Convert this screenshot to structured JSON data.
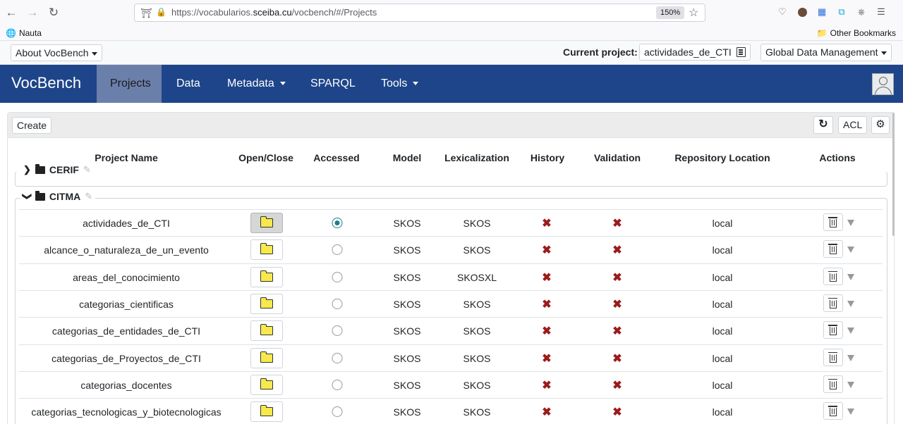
{
  "browser": {
    "url_prefix": "https://vocabularios.",
    "url_domain": "sceiba.cu",
    "url_path": "/vocbench/#/Projects",
    "zoom": "150%",
    "bookmark_nauta": "Nauta",
    "bookmark_other": "Other Bookmarks"
  },
  "topbar": {
    "about": "About VocBench",
    "current_project_label": "Current project:",
    "current_project": "actividades_de_CTI",
    "global": "Global Data Management"
  },
  "navbar": {
    "brand": "VocBench",
    "items": [
      "Projects",
      "Data",
      "Metadata",
      "SPARQL",
      "Tools"
    ]
  },
  "panel": {
    "create": "Create",
    "acl": "ACL"
  },
  "columns": [
    "Project Name",
    "Open/Close",
    "Accessed",
    "Model",
    "Lexicalization",
    "History",
    "Validation",
    "Repository Location",
    "Actions"
  ],
  "groups": [
    {
      "name": "CERIF"
    },
    {
      "name": "CITMA"
    }
  ],
  "projects": [
    {
      "name": "actividades_de_CTI",
      "open": true,
      "accessed": true,
      "model": "SKOS",
      "lex": "SKOS",
      "history": "✖",
      "validation": "✖",
      "location": "local"
    },
    {
      "name": "alcance_o_naturaleza_de_un_evento",
      "open": false,
      "accessed": false,
      "model": "SKOS",
      "lex": "SKOS",
      "history": "✖",
      "validation": "✖",
      "location": "local"
    },
    {
      "name": "areas_del_conocimiento",
      "open": false,
      "accessed": false,
      "model": "SKOS",
      "lex": "SKOSXL",
      "history": "✖",
      "validation": "✖",
      "location": "local"
    },
    {
      "name": "categorias_cientificas",
      "open": false,
      "accessed": false,
      "model": "SKOS",
      "lex": "SKOS",
      "history": "✖",
      "validation": "✖",
      "location": "local"
    },
    {
      "name": "categorias_de_entidades_de_CTI",
      "open": false,
      "accessed": false,
      "model": "SKOS",
      "lex": "SKOS",
      "history": "✖",
      "validation": "✖",
      "location": "local"
    },
    {
      "name": "categorias_de_Proyectos_de_CTI",
      "open": false,
      "accessed": false,
      "model": "SKOS",
      "lex": "SKOS",
      "history": "✖",
      "validation": "✖",
      "location": "local"
    },
    {
      "name": "categorias_docentes",
      "open": false,
      "accessed": false,
      "model": "SKOS",
      "lex": "SKOS",
      "history": "✖",
      "validation": "✖",
      "location": "local"
    },
    {
      "name": "categorias_tecnologicas_y_biotecnologicas",
      "open": false,
      "accessed": false,
      "model": "SKOS",
      "lex": "SKOS",
      "history": "✖",
      "validation": "✖",
      "location": "local"
    }
  ]
}
